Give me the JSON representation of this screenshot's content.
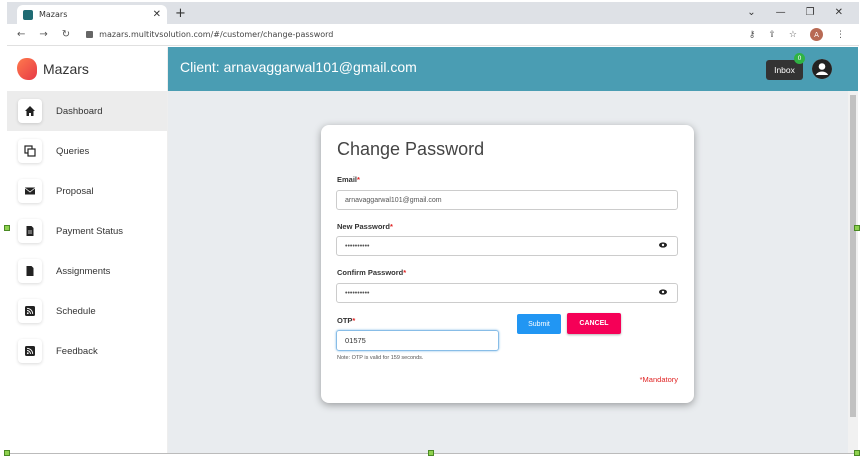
{
  "browser": {
    "tab_title": "Mazars",
    "tab_close": "✕",
    "new_tab": "+",
    "url": "mazars.multitvsolution.com/#/customer/change-password",
    "win_min": "⌄",
    "win_dash": "—",
    "win_restore": "❐",
    "win_close": "✕",
    "profile_initial": "A"
  },
  "sidebar": {
    "brand": "Mazars",
    "items": [
      {
        "label": "Dashboard",
        "icon": "home-icon"
      },
      {
        "label": "Queries",
        "icon": "copy-icon"
      },
      {
        "label": "Proposal",
        "icon": "envelope-icon"
      },
      {
        "label": "Payment Status",
        "icon": "file-icon"
      },
      {
        "label": "Assignments",
        "icon": "file-solid-icon"
      },
      {
        "label": "Schedule",
        "icon": "rss-icon"
      },
      {
        "label": "Feedback",
        "icon": "rss-icon"
      }
    ]
  },
  "header": {
    "client_text": "Client: arnavaggarwal101@gmail.com",
    "inbox_label": "Inbox",
    "inbox_count": "0",
    "header_color": "#4a9db3"
  },
  "form": {
    "title": "Change Password",
    "email_label": "Email",
    "email_value": "arnavaggarwal101@gmail.com",
    "new_password_label": "New Password",
    "new_password_value": "••••••••••",
    "confirm_password_label": "Confirm Password",
    "confirm_password_value": "••••••••••",
    "otp_label": "OTP",
    "otp_value": "01575",
    "note": "Note: OTP is valid for 159 seconds.",
    "submit_label": "Submit",
    "cancel_label": "CANCEL",
    "mandatory": "*Mandatory",
    "required_mark": "*"
  }
}
